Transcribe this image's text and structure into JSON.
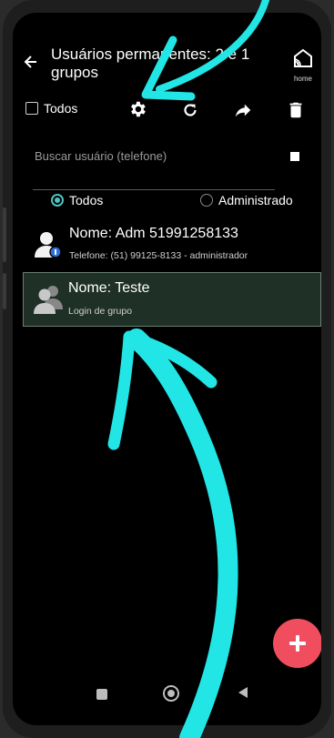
{
  "header": {
    "title": "Usuários permanentes: 2 e 1 grupos",
    "home_label": "home"
  },
  "toolbar": {
    "select_all_label": "Todos"
  },
  "search": {
    "placeholder": "Buscar usuário (telefone)"
  },
  "filter": {
    "options": [
      {
        "label": "Todos",
        "selected": true
      },
      {
        "label": "Administrado",
        "selected": false
      }
    ]
  },
  "users": [
    {
      "name": "Nome: Adm 51991258133",
      "detail": "Telefone: (51) 99125-8133 - administrador",
      "icon": "user-admin-icon",
      "selected": false
    },
    {
      "name": "Nome: Teste",
      "detail": "Login de grupo",
      "icon": "group-icon",
      "selected": true
    }
  ],
  "colors": {
    "accent": "#4fc3c0",
    "fab": "#f04e5e",
    "selected_row": "#1f3027",
    "annotation_arrow": "#22e6e6"
  }
}
